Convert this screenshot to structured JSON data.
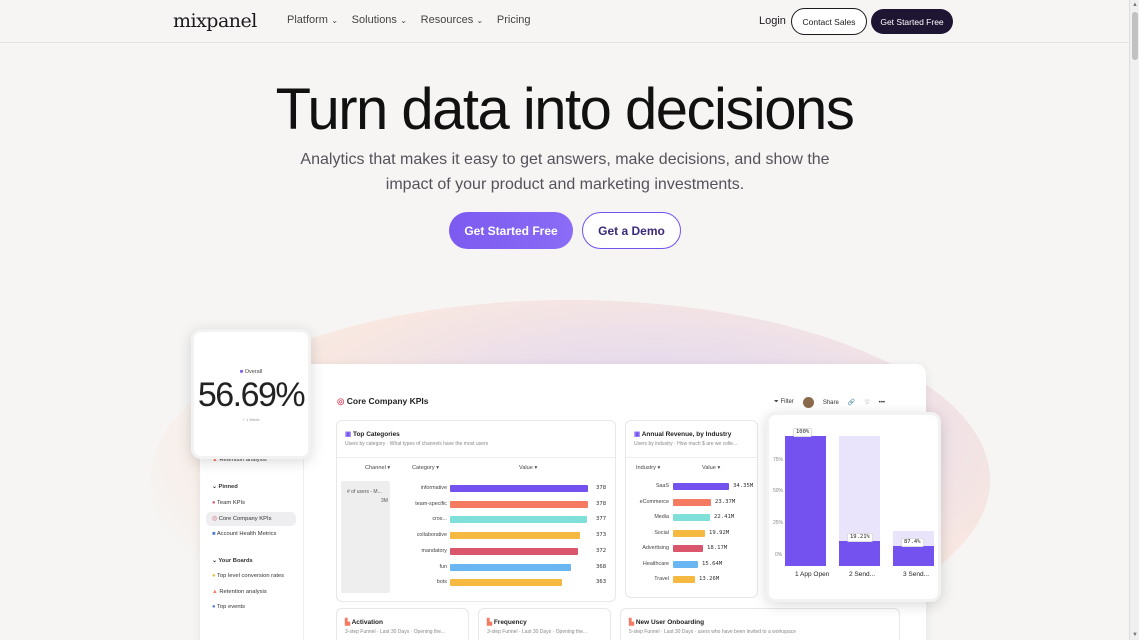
{
  "brand": {
    "logo": "mixpanel"
  },
  "nav": {
    "items": [
      {
        "label": "Platform",
        "chevron": true
      },
      {
        "label": "Solutions",
        "chevron": true
      },
      {
        "label": "Resources",
        "chevron": true
      },
      {
        "label": "Pricing",
        "chevron": false
      }
    ],
    "login": "Login",
    "contact_sales": "Contact Sales",
    "get_started": "Get Started Free"
  },
  "hero": {
    "title": "Turn data into decisions",
    "subtitle": "Analytics that makes it easy to get answers, make decisions, and show the impact of your product and marketing investments.",
    "primary_cta": "Get Started Free",
    "secondary_cta": "Get a Demo"
  },
  "dashboard": {
    "title": "Core Company KPIs",
    "toolbar": {
      "filter": "Filter",
      "share": "Share"
    },
    "sidebar": {
      "partial_item": "Retention analysis",
      "pinned_header": "Pinned",
      "pinned": [
        "Team KPIs",
        "Core Company KPIs",
        "Account Health Metrics"
      ],
      "boards_header": "Your Boards",
      "boards": [
        "Top level conversion rates",
        "Retention analysis",
        "Top events"
      ]
    },
    "top_categories": {
      "title": "Top Categories",
      "subtitle": "Users by category · What types of channels have the most users",
      "columns": [
        "Channel",
        "Category",
        "Value"
      ],
      "metric_label": "# of users - M...",
      "metric_total": "3M",
      "rows": [
        {
          "label": "informative",
          "value": 378,
          "color": "#7452f0"
        },
        {
          "label": "team-specific",
          "value": 378,
          "color": "#f47a62"
        },
        {
          "label": "cros...",
          "value": 377,
          "color": "#7ee0d8"
        },
        {
          "label": "collaborative",
          "value": 373,
          "color": "#f5b942"
        },
        {
          "label": "mandatory",
          "value": 372,
          "color": "#d9566c"
        },
        {
          "label": "fun",
          "value": 368,
          "color": "#6ab6f2"
        },
        {
          "label": "bots",
          "value": 363,
          "color": "#f5b942"
        }
      ]
    },
    "annual_revenue": {
      "title": "Annual Revenue, by Industry",
      "subtitle": "Users by industry · How much $ are we colle...",
      "columns": [
        "Industry",
        "Value"
      ],
      "rows": [
        {
          "label": "SaaS",
          "value": "34.35M",
          "num": 34.35,
          "color": "#7452f0"
        },
        {
          "label": "eCommerce",
          "value": "23.37M",
          "num": 23.37,
          "color": "#f47a62"
        },
        {
          "label": "Media",
          "value": "22.41M",
          "num": 22.41,
          "color": "#7ee0d8"
        },
        {
          "label": "Social",
          "value": "19.92M",
          "num": 19.92,
          "color": "#f5b942"
        },
        {
          "label": "Advertising",
          "value": "18.17M",
          "num": 18.17,
          "color": "#d9566c"
        },
        {
          "label": "Healthcare",
          "value": "15.64M",
          "num": 15.64,
          "color": "#6ab6f2"
        },
        {
          "label": "Travel",
          "value": "13.26M",
          "num": 13.26,
          "color": "#f5b942"
        }
      ]
    },
    "bottom_cards": [
      {
        "title": "Activation",
        "subtitle": "3-step Funnel · Last 30 Days · Opening the..."
      },
      {
        "title": "Frequency",
        "subtitle": "3-step Funnel · Last 30 Days · Opening the..."
      },
      {
        "title": "New User Onboarding",
        "subtitle": "5-step Funnel · Last 30 Days · users who have been invited to a workspace"
      }
    ]
  },
  "overall_card": {
    "label": "Overall",
    "value": "56.69%",
    "note": "+ 1 Week"
  },
  "funnel_card": {
    "y_ticks": [
      "75%",
      "50%",
      "25%",
      "0%"
    ],
    "steps": [
      {
        "label": "1 App Open",
        "pct": "100%",
        "value": 100
      },
      {
        "label": "2 Send...",
        "pct": "19.21%",
        "value": 19.21
      },
      {
        "label": "3 Send...",
        "pct": "87.4%",
        "value": 15.6
      }
    ]
  }
}
